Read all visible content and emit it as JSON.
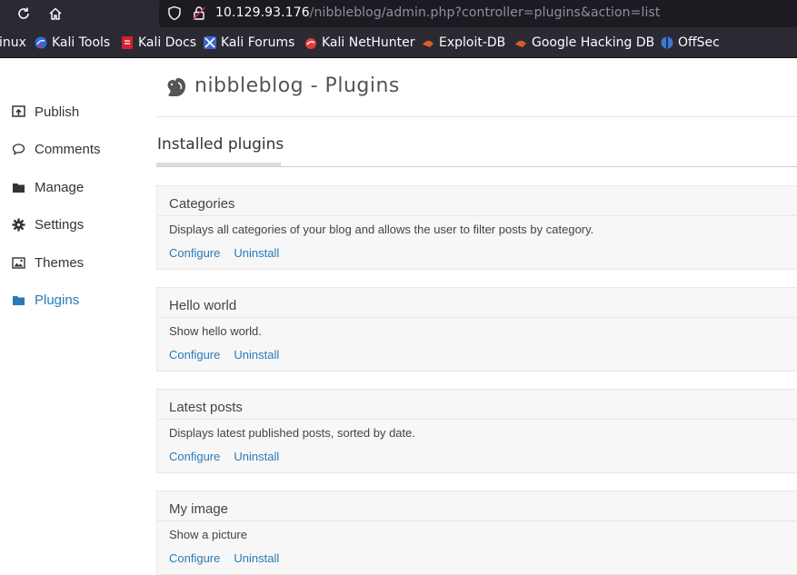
{
  "browser": {
    "url_host": "10.129.93.176",
    "url_path": "/nibbleblog/admin.php?controller=plugins&action=list"
  },
  "bookmarks": [
    {
      "label": "inux",
      "icon": "none"
    },
    {
      "label": "Kali Tools",
      "icon": "kali-tools-icon"
    },
    {
      "label": "Kali Docs",
      "icon": "kali-docs-icon"
    },
    {
      "label": "Kali Forums",
      "icon": "kali-forums-icon"
    },
    {
      "label": "Kali NetHunter",
      "icon": "kali-nethunter-icon"
    },
    {
      "label": "Exploit-DB",
      "icon": "exploit-db-icon"
    },
    {
      "label": "Google Hacking DB",
      "icon": "ghdb-icon"
    },
    {
      "label": "OffSec",
      "icon": "offsec-icon"
    }
  ],
  "sidebar": {
    "items": [
      {
        "label": "Publish",
        "icon": "publish-icon"
      },
      {
        "label": "Comments",
        "icon": "comments-icon"
      },
      {
        "label": "Manage",
        "icon": "folder-icon"
      },
      {
        "label": "Settings",
        "icon": "gear-icon"
      },
      {
        "label": "Themes",
        "icon": "image-icon"
      },
      {
        "label": "Plugins",
        "icon": "folder-icon",
        "active": true
      }
    ]
  },
  "header": {
    "title": "nibbleblog - Plugins"
  },
  "section": {
    "title": "Installed plugins"
  },
  "plugins": [
    {
      "name": "Categories",
      "description": "Displays all categories of your blog and allows the user to filter posts by category.",
      "configure": "Configure",
      "uninstall": "Uninstall"
    },
    {
      "name": "Hello world",
      "description": "Show hello world.",
      "configure": "Configure",
      "uninstall": "Uninstall"
    },
    {
      "name": "Latest posts",
      "description": "Displays latest published posts, sorted by date.",
      "configure": "Configure",
      "uninstall": "Uninstall"
    },
    {
      "name": "My image",
      "description": "Show a picture",
      "configure": "Configure",
      "uninstall": "Uninstall"
    }
  ],
  "colors": {
    "chrome_bg": "#2b2a33",
    "link": "#2a7ab8",
    "panel_bg": "#f7f7f7"
  }
}
